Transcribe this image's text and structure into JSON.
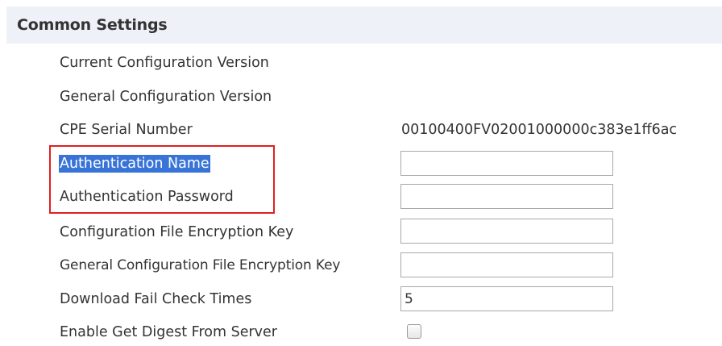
{
  "section": {
    "title": "Common Settings"
  },
  "rows": [
    {
      "label": "Current Configuration Version"
    },
    {
      "label": "General Configuration Version"
    },
    {
      "label": "CPE Serial Number",
      "value": "00100400FV02001000000c383e1ff6ac"
    },
    {
      "label": "Authentication Name",
      "value": ""
    },
    {
      "label": "Authentication Password",
      "value": ""
    },
    {
      "label": "Configuration File Encryption Key",
      "value": ""
    },
    {
      "label": "General Configuration File Encryption Key",
      "value": ""
    },
    {
      "label": "Download Fail Check Times",
      "value": "5"
    },
    {
      "label": "Enable Get Digest From Server",
      "checked": false
    }
  ],
  "colors": {
    "highlight_border": "#e02020",
    "selection": "#3874d8",
    "header_background": "#eef2f8"
  }
}
